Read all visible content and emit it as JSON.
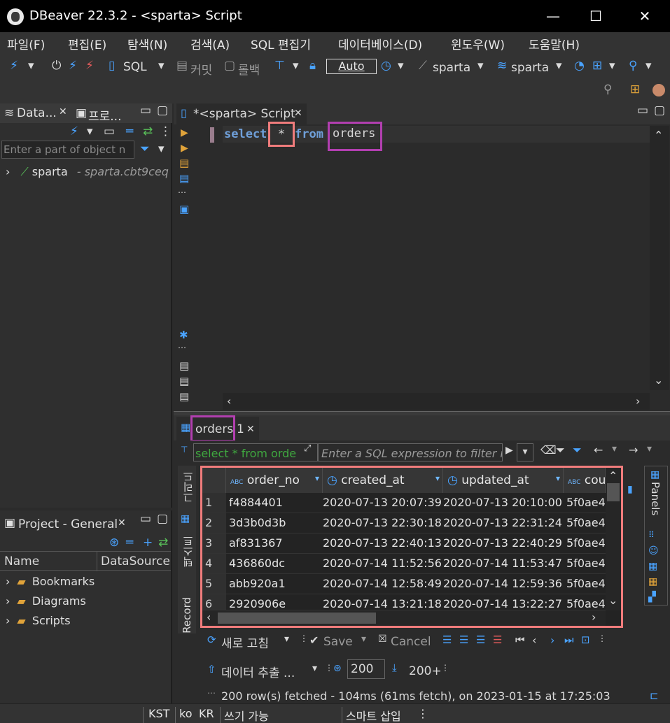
{
  "window": {
    "title": "DBeaver 22.3.2 - <sparta> Script",
    "minimize": "—",
    "maximize": "☐",
    "close": "✕"
  },
  "menu": [
    "파일(F)",
    "편집(E)",
    "탐색(N)",
    "검색(A)",
    "SQL 편집기",
    "데이터베이스(D)",
    "윈도우(W)",
    "도움말(H)"
  ],
  "toolbar": {
    "sql": "SQL",
    "commit": "커밋",
    "rollback": "롤백",
    "auto": "Auto",
    "datasource": "sparta",
    "schema": "sparta"
  },
  "navigator": {
    "tab1": "Data...",
    "tab2": "프로...",
    "filter_placeholder": "Enter a part of object n",
    "connection": "sparta",
    "connection_host": "- sparta.cbt9ceq"
  },
  "project": {
    "tab": "Project - General",
    "col_name": "Name",
    "col_datasource": "DataSource",
    "items": [
      "Bookmarks",
      "Diagrams",
      "Scripts"
    ]
  },
  "editor": {
    "tab": "*<sparta> Script",
    "sql": {
      "select": "select",
      "star": "*",
      "from": "from",
      "table": "orders"
    }
  },
  "results": {
    "tab": "orders",
    "tab_suffix": "1",
    "filter_query": "select * from orde",
    "filter_placeholder": "Enter a SQL expression to filter r",
    "vtabs": {
      "grid": "그리드",
      "text": "텍스트",
      "record": "Record"
    },
    "panels": "Panels",
    "columns": [
      "order_no",
      "created_at",
      "updated_at",
      "cou"
    ],
    "rows": [
      {
        "n": "1",
        "order_no": "f4884401",
        "created_at": "2020-07-13 20:07:39",
        "updated_at": "2020-07-13 20:10:00",
        "cou": "5f0ae4"
      },
      {
        "n": "2",
        "order_no": "3d3b0d3b",
        "created_at": "2020-07-13 22:30:18",
        "updated_at": "2020-07-13 22:31:24",
        "cou": "5f0ae4"
      },
      {
        "n": "3",
        "order_no": "af831367",
        "created_at": "2020-07-13 22:40:13",
        "updated_at": "2020-07-13 22:40:29",
        "cou": "5f0ae4"
      },
      {
        "n": "4",
        "order_no": "436860dc",
        "created_at": "2020-07-14 11:52:56",
        "updated_at": "2020-07-14 11:53:47",
        "cou": "5f0ae4"
      },
      {
        "n": "5",
        "order_no": "abb920a1",
        "created_at": "2020-07-14 12:58:49",
        "updated_at": "2020-07-14 12:59:36",
        "cou": "5f0ae4"
      },
      {
        "n": "6",
        "order_no": "2920906e",
        "created_at": "2020-07-14 13:21:18",
        "updated_at": "2020-07-14 13:22:27",
        "cou": "5f0ae4"
      }
    ],
    "refresh": "새로 고침",
    "save": "Save",
    "cancel": "Cancel",
    "export": "데이터 추출 ...",
    "fetch_size": "200",
    "fetch_more": "200+",
    "status": "200 row(s) fetched - 104ms (61ms fetch), on 2023-01-15 at 17:25:03"
  },
  "statusbar": {
    "tz": "KST",
    "lang": "ko",
    "region": "KR",
    "mode": "쓰기 가능",
    "insert": "스마트 삽입"
  },
  "colors": {
    "highlight_salmon": "#f07c7c",
    "highlight_purple": "#b23fb0",
    "keyword": "#6f9fd8",
    "icon_blue": "#4aa3ff"
  }
}
